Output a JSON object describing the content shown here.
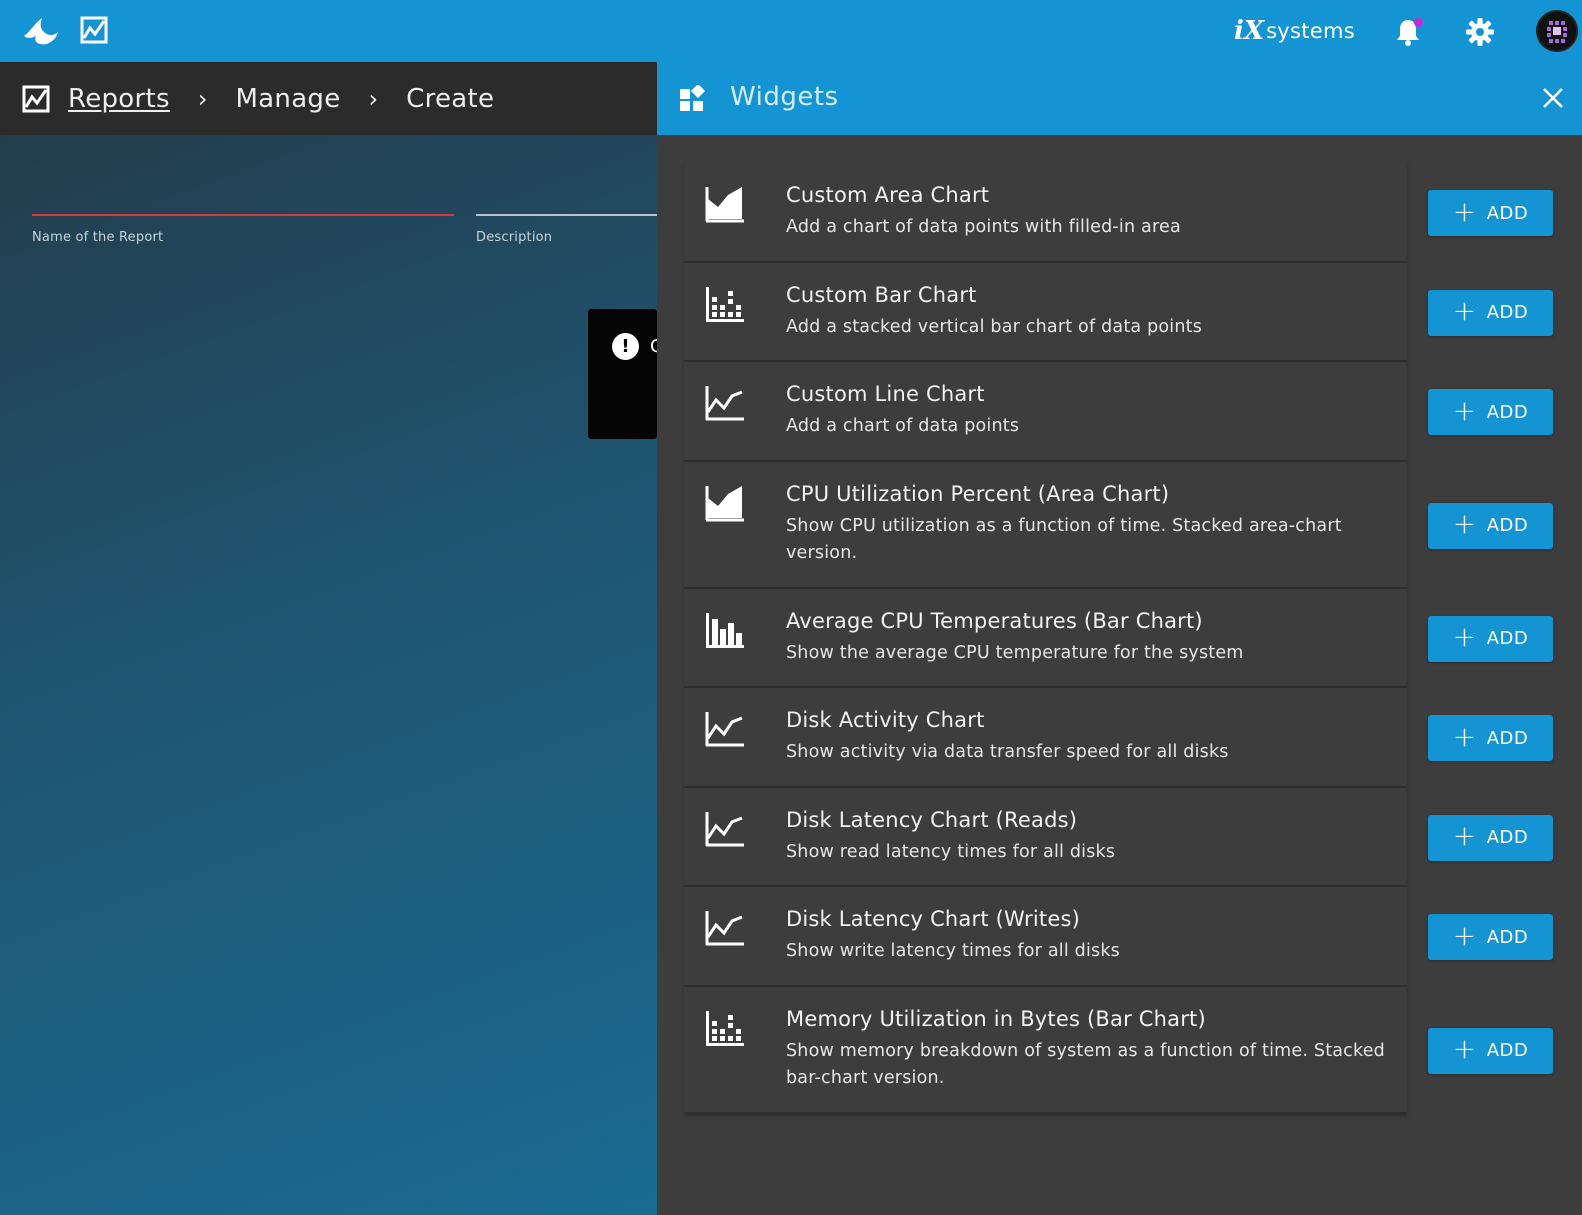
{
  "topbar": {
    "logo_icon": "freenas-logo-icon",
    "reports_icon": "reports-chart-icon",
    "brand_mark": "iX",
    "brand_text": "systems",
    "notifications_icon": "bell-icon",
    "settings_icon": "gear-icon",
    "user_icon": "avatar"
  },
  "breadcrumb": {
    "items": [
      "Reports",
      "Manage",
      "Create"
    ],
    "separator": "›"
  },
  "form": {
    "name_label": "Name of the Report",
    "description_label": "Description"
  },
  "alert": {
    "icon": "!",
    "text": "C"
  },
  "panel": {
    "title": "Widgets",
    "close_icon": "close-icon",
    "widgets": [
      {
        "icon": "area-chart-icon",
        "title": "Custom Area Chart",
        "description": "Add a chart of data points with filled-in area",
        "button": "ADD"
      },
      {
        "icon": "stacked-bar-chart-icon",
        "title": "Custom Bar Chart",
        "description": "Add a stacked vertical bar chart of data points",
        "button": "ADD"
      },
      {
        "icon": "line-chart-icon",
        "title": "Custom Line Chart",
        "description": "Add a chart of data points",
        "button": "ADD"
      },
      {
        "icon": "area-chart-icon",
        "title": "CPU Utilization Percent (Area Chart)",
        "description": "Show CPU utilization as a function of time. Stacked area-chart version.",
        "button": "ADD"
      },
      {
        "icon": "bar-chart-icon",
        "title": "Average CPU Temperatures (Bar Chart)",
        "description": "Show the average CPU temperature for the system",
        "button": "ADD"
      },
      {
        "icon": "line-chart-icon",
        "title": "Disk Activity Chart",
        "description": "Show activity via data transfer speed for all disks",
        "button": "ADD"
      },
      {
        "icon": "line-chart-icon",
        "title": "Disk Latency Chart (Reads)",
        "description": "Show read latency times for all disks",
        "button": "ADD"
      },
      {
        "icon": "line-chart-icon",
        "title": "Disk Latency Chart (Writes)",
        "description": "Show write latency times for all disks",
        "button": "ADD"
      },
      {
        "icon": "stacked-bar-chart-icon",
        "title": "Memory Utilization in Bytes (Bar Chart)",
        "description": "Show memory breakdown of system as a function of time. Stacked bar-chart version.",
        "button": "ADD"
      }
    ]
  },
  "colors": {
    "accent": "#1494d2",
    "panel_bg": "#3d3d3d",
    "crumbbar_bg": "#2b2b2b",
    "error_underline": "#d63b3b"
  }
}
